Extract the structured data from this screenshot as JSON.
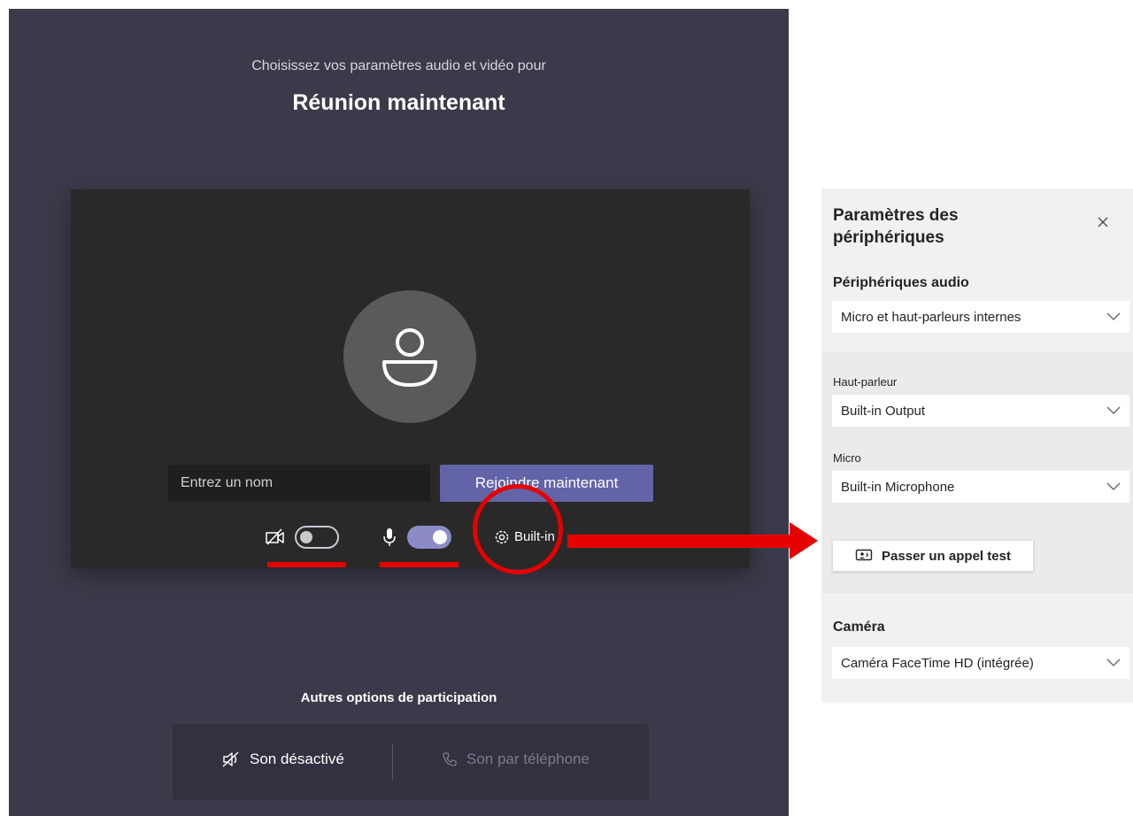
{
  "prejoin": {
    "subtitle": "Choisissez vos paramètres audio et vidéo pour",
    "meeting_title": "Réunion maintenant",
    "name_placeholder": "Entrez un nom",
    "join_label": "Rejoindre maintenant",
    "device_settings_label": "Built-in",
    "video_toggle_on": false,
    "mic_toggle_on": true,
    "other_options_title": "Autres options de participation",
    "mute_option_label": "Son désactivé",
    "phone_option_label": "Son par téléphone"
  },
  "device_panel": {
    "title": "Paramètres des périphériques",
    "audio_devices_label": "Périphériques audio",
    "audio_devices_value": "Micro et haut-parleurs internes",
    "speaker_label": "Haut-parleur",
    "speaker_value": "Built-in Output",
    "mic_label": "Micro",
    "mic_value": "Built-in Microphone",
    "test_call_label": "Passer un appel test",
    "camera_label": "Caméra",
    "camera_value": "Caméra FaceTime HD (intégrée)"
  },
  "colors": {
    "accent": "#6264a7",
    "annotation": "#e60000",
    "stage_bg": "#3b3a4a",
    "card_bg": "#292929"
  }
}
